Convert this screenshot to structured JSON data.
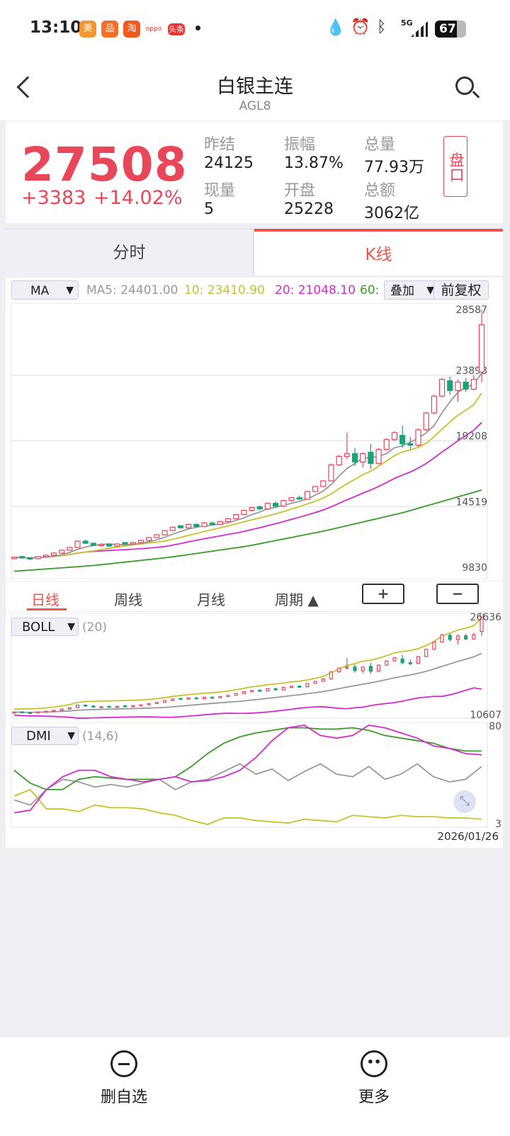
{
  "status_bar": {
    "time": "13:10",
    "battery": "67",
    "network": "5G",
    "apps": [
      "美",
      "品",
      "淘",
      "oppo",
      "头条"
    ]
  },
  "header": {
    "title": "白银主连",
    "code": "AGL8"
  },
  "quote": {
    "price": "27508",
    "change": "+3383",
    "change_pct": "+14.02%",
    "stats": [
      {
        "label": "昨结",
        "value": "24125"
      },
      {
        "label": "振幅",
        "value": "13.87%"
      },
      {
        "label": "总量",
        "value": "77.93万"
      },
      {
        "label": "现量",
        "value": "5"
      },
      {
        "label": "开盘",
        "value": "25228"
      },
      {
        "label": "总额",
        "value": "3062亿"
      }
    ],
    "depth_button": "盘口"
  },
  "tabs": [
    {
      "label": "分时"
    },
    {
      "label": "K线",
      "active": true
    }
  ],
  "indicator_bar": {
    "select": "MA",
    "ma5": "MA5: 24401.00",
    "ma10": "10: 23410.90",
    "ma20": "20: 21048.10",
    "ma60": "60:",
    "overlay": "叠加",
    "adjust": "前复权"
  },
  "period_bar": {
    "items": [
      "日线",
      "周线",
      "月线",
      "周期 ▲"
    ],
    "zoom_in": "+",
    "zoom_out": "−"
  },
  "boll": {
    "select": "BOLL",
    "param": "(20)",
    "max": "26636",
    "min": "10607"
  },
  "dmi": {
    "select": "DMI",
    "param": "(14,6)",
    "max": "80",
    "min": "3",
    "date": "2026/01/26"
  },
  "bottom_nav": [
    {
      "label": "删自选",
      "icon": "minus-circle-icon"
    },
    {
      "label": "更多",
      "icon": "more-icon"
    }
  ],
  "colors": {
    "up": "#e8475a",
    "down": "#1aa37a",
    "ma5": "#999999",
    "ma10": "#c8c22a",
    "ma20": "#d62ad0",
    "ma60": "#3a9a2a",
    "accent": "#f0544a"
  },
  "chart_data": {
    "type": "candlestick",
    "ylim": [
      9830,
      28587
    ],
    "y_ticks": [
      "28587",
      "23898",
      "19208",
      "14519",
      "9830"
    ],
    "candles": [
      [
        10800,
        10950,
        10750,
        10900
      ],
      [
        10950,
        11000,
        10800,
        10850
      ],
      [
        10850,
        10900,
        10700,
        10800
      ],
      [
        10800,
        10980,
        10760,
        10950
      ],
      [
        10950,
        11100,
        10900,
        11050
      ],
      [
        11050,
        11250,
        11000,
        11200
      ],
      [
        11200,
        11450,
        11150,
        11400
      ],
      [
        11400,
        11650,
        11350,
        11600
      ],
      [
        11600,
        12100,
        11550,
        12050
      ],
      [
        12050,
        12150,
        11850,
        11900
      ],
      [
        11900,
        11950,
        11700,
        11750
      ],
      [
        11750,
        11900,
        11650,
        11800
      ],
      [
        11850,
        11900,
        11650,
        11700
      ],
      [
        11700,
        11900,
        11650,
        11850
      ],
      [
        11950,
        12000,
        11800,
        11850
      ],
      [
        11850,
        12000,
        11800,
        11950
      ],
      [
        11950,
        12150,
        11900,
        12100
      ],
      [
        12100,
        12350,
        12050,
        12300
      ],
      [
        12300,
        12550,
        12250,
        12500
      ],
      [
        12500,
        12850,
        12450,
        12800
      ],
      [
        12800,
        13100,
        12750,
        13050
      ],
      [
        13150,
        13200,
        12950,
        13000
      ],
      [
        13000,
        13300,
        12950,
        13250
      ],
      [
        13250,
        13300,
        13000,
        13100
      ],
      [
        13100,
        13400,
        13050,
        13350
      ],
      [
        13350,
        13450,
        13150,
        13250
      ],
      [
        13250,
        13500,
        13200,
        13450
      ],
      [
        13450,
        13700,
        13400,
        13650
      ],
      [
        13650,
        14000,
        13600,
        13950
      ],
      [
        13950,
        14300,
        13900,
        14250
      ],
      [
        14250,
        14500,
        14150,
        14450
      ],
      [
        14500,
        14600,
        14250,
        14350
      ],
      [
        14350,
        14800,
        14300,
        14750
      ],
      [
        14750,
        14900,
        14450,
        14550
      ],
      [
        14550,
        15000,
        14500,
        14950
      ],
      [
        14950,
        15200,
        14850,
        15150
      ],
      [
        15150,
        15300,
        15000,
        15050
      ],
      [
        15050,
        15650,
        15000,
        15600
      ],
      [
        15600,
        16000,
        15550,
        15950
      ],
      [
        15950,
        16400,
        15900,
        16350
      ],
      [
        16350,
        17600,
        16300,
        17500
      ],
      [
        17500,
        18200,
        17400,
        18100
      ],
      [
        18100,
        19800,
        17900,
        18300
      ],
      [
        18300,
        18700,
        17400,
        17700
      ],
      [
        17700,
        18400,
        17300,
        18300
      ],
      [
        18400,
        19000,
        17200,
        17600
      ],
      [
        17600,
        18700,
        17500,
        18600
      ],
      [
        18600,
        19400,
        18500,
        19300
      ],
      [
        19300,
        19900,
        19200,
        19800
      ],
      [
        19600,
        20300,
        18700,
        19000
      ],
      [
        19000,
        19500,
        18600,
        18900
      ],
      [
        18900,
        20100,
        18800,
        20000
      ],
      [
        20000,
        21300,
        19900,
        21200
      ],
      [
        21200,
        22500,
        21100,
        22400
      ],
      [
        22400,
        23700,
        22300,
        23600
      ],
      [
        23500,
        23800,
        22500,
        22800
      ],
      [
        22800,
        23600,
        22000,
        23400
      ],
      [
        23400,
        23700,
        22700,
        22900
      ],
      [
        22900,
        23900,
        22800,
        23600
      ],
      [
        24125,
        28587,
        23400,
        27508
      ]
    ],
    "ma60_keypoints": [
      9900,
      10300,
      10900,
      11700,
      12800,
      14100,
      15700
    ],
    "boll_ylim": [
      10607,
      26636
    ],
    "dmi_ylim": [
      3,
      80
    ],
    "dmi": {
      "pdi": [
        12,
        14,
        30,
        40,
        45,
        45,
        40,
        38,
        36,
        38,
        40,
        36,
        37,
        40,
        45,
        55,
        68,
        78,
        80,
        72,
        70,
        72,
        80,
        78,
        74,
        70,
        64,
        62,
        58,
        57
      ],
      "adx": [
        45,
        35,
        30,
        30,
        38,
        40,
        39,
        38,
        38,
        38,
        40,
        48,
        58,
        66,
        71,
        74,
        76,
        78,
        78,
        77,
        77,
        78,
        76,
        72,
        70,
        68,
        66,
        62,
        60,
        60
      ],
      "adxr": [
        22,
        18,
        30,
        38,
        36,
        32,
        34,
        32,
        35,
        38,
        30,
        36,
        38,
        44,
        50,
        42,
        46,
        37,
        44,
        50,
        42,
        40,
        48,
        38,
        42,
        50,
        40,
        36,
        38,
        48
      ],
      "mdi": [
        25,
        30,
        15,
        15,
        13,
        18,
        16,
        16,
        15,
        12,
        10,
        6,
        3,
        8,
        8,
        6,
        5,
        4,
        7,
        6,
        5,
        10,
        9,
        8,
        10,
        9,
        9,
        8,
        8,
        7
      ]
    }
  }
}
